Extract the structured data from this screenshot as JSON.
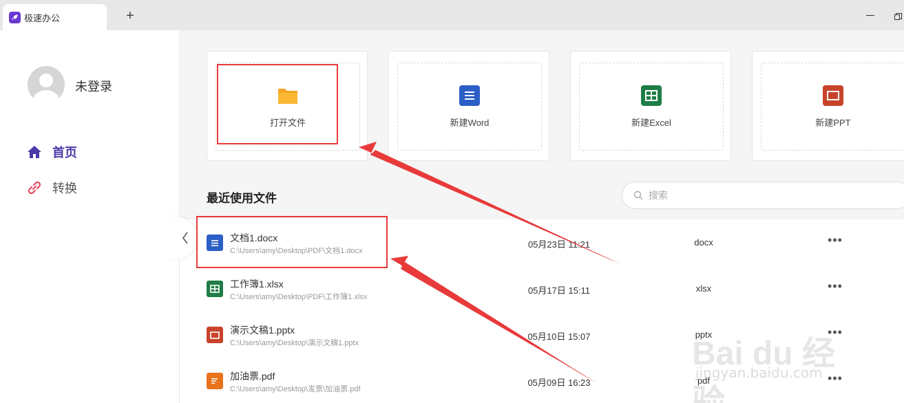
{
  "titlebar": {
    "tab_title": "极速办公",
    "new_tab_symbol": "+"
  },
  "sidebar": {
    "user_name": "未登录",
    "nav": [
      {
        "label": "首页",
        "icon": "home-icon",
        "active": true
      },
      {
        "label": "转换",
        "icon": "convert-icon",
        "active": false
      }
    ]
  },
  "actions": [
    {
      "label": "打开文件",
      "icon": "folder-icon",
      "color": "#f5a623"
    },
    {
      "label": "新建Word",
      "icon": "word-doc-icon",
      "color": "#2b5fc7"
    },
    {
      "label": "新建Excel",
      "icon": "excel-sheet-icon",
      "color": "#1e7d45"
    },
    {
      "label": "新建PPT",
      "icon": "ppt-slide-icon",
      "color": "#c8432a"
    }
  ],
  "recent": {
    "title": "最近使用文件",
    "search_placeholder": "搜索",
    "more_symbol": "•••",
    "files": [
      {
        "name": "文档1.docx",
        "path": "C:\\Users\\amy\\Desktop\\PDF\\文档1.docx",
        "date": "05月23日 11:21",
        "type": "docx",
        "icon": "word-doc-icon",
        "color": "#2b5fc7"
      },
      {
        "name": "工作簿1.xlsx",
        "path": "C:\\Users\\amy\\Desktop\\PDF\\工作簿1.xlsx",
        "date": "05月17日 15:11",
        "type": "xlsx",
        "icon": "excel-sheet-icon",
        "color": "#1e7d45"
      },
      {
        "name": "演示文稿1.pptx",
        "path": "C:\\Users\\amy\\Desktop\\演示文稿1.pptx",
        "date": "05月10日 15:07",
        "type": "pptx",
        "icon": "ppt-slide-icon",
        "color": "#c8432a"
      },
      {
        "name": "加油票.pdf",
        "path": "C:\\Users\\amy\\Desktop\\发票\\加油票.pdf",
        "date": "05月09日 16:23",
        "type": "pdf",
        "icon": "pdf-doc-icon",
        "color": "#e8731c"
      }
    ]
  },
  "annotation_color": "#e83a3a",
  "watermark": {
    "brand": "Bai du 经验",
    "url": "jingyan.baidu.com"
  }
}
